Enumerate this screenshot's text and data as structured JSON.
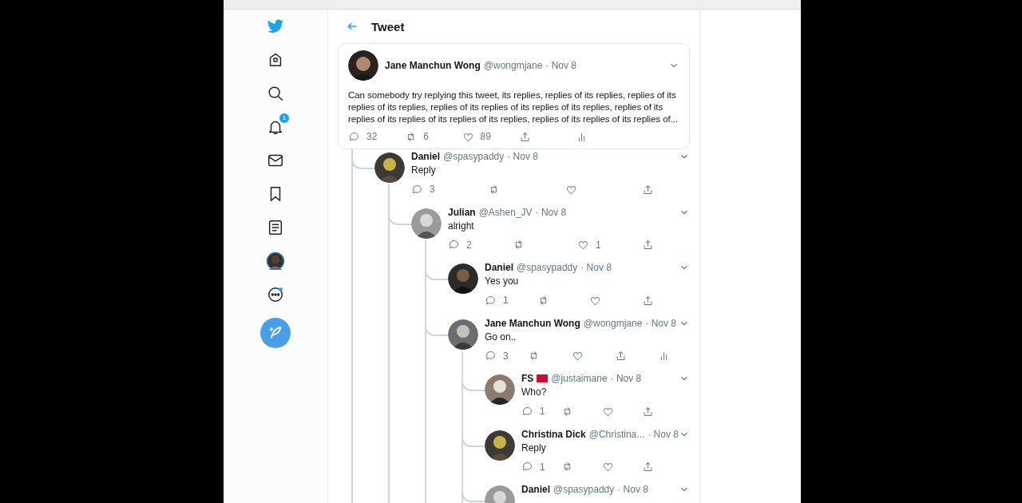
{
  "sidebar": {
    "notification_count": "1"
  },
  "header": {
    "title": "Tweet"
  },
  "main_tweet": {
    "name": "Jane Manchun Wong",
    "handle": "@wongmjane",
    "date": "· Nov 8",
    "text": "Can somebody try replying this tweet, its replies, replies of its replies, replies of its replies of its replies, replies of its replies of its replies of its replies, replies of its replies of its replies of its replies of its replies, replies of its replies of its replies of...",
    "actions": {
      "replies": "32",
      "retweets": "6",
      "likes": "89",
      "analytics": true
    }
  },
  "replies": [
    {
      "name": "Daniel",
      "handle": "@spasypaddy",
      "date": "· Nov 8",
      "text": "Reply",
      "actions": {
        "replies": "3",
        "analytics": false
      },
      "children": [
        {
          "name": "Julian",
          "handle": "@Ashen_JV",
          "date": "· Nov 8",
          "text": "alright",
          "actions": {
            "replies": "2",
            "likes": "1",
            "analytics": false
          },
          "children": [
            {
              "name": "Daniel",
              "handle": "@spasypaddy",
              "date": "· Nov 8",
              "text": "Yes you",
              "actions": {
                "replies": "1",
                "analytics": false
              }
            },
            {
              "name": "Jane Manchun Wong",
              "handle": "@wongmjane",
              "date": "· Nov 8",
              "text": "Go on..",
              "actions": {
                "replies": "3",
                "analytics": true
              },
              "children": [
                {
                  "name": "FS",
                  "flag": true,
                  "handle": "@justaimane",
                  "date": "· Nov 8",
                  "text": "Who?",
                  "actions": {
                    "replies": "1",
                    "analytics": false
                  }
                },
                {
                  "name": "Christina Dick",
                  "handle": "@Christina...",
                  "date": "· Nov 8",
                  "text": "Reply",
                  "actions": {
                    "replies": "1",
                    "analytics": false
                  }
                },
                {
                  "name": "Daniel",
                  "handle": "@spasypaddy",
                  "date": "· Nov 8"
                }
              ]
            }
          ]
        }
      ]
    }
  ]
}
